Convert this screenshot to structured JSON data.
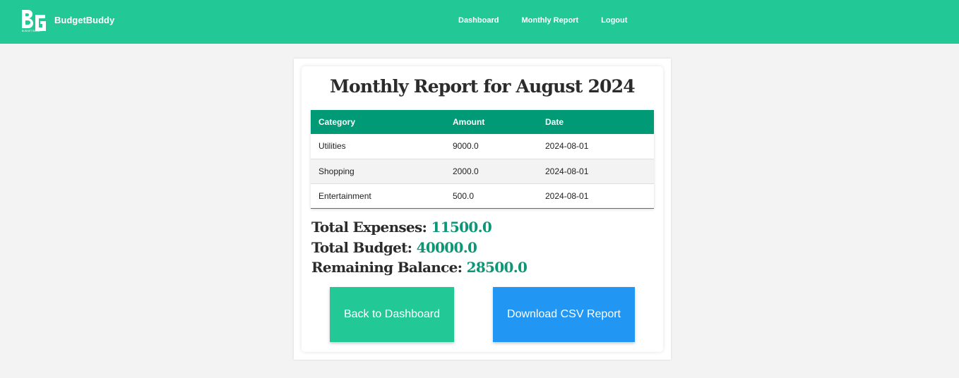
{
  "app": {
    "brand": "BudgetBuddy",
    "logo_text": "BG",
    "logo_tagline": "BUDGET BUDDY"
  },
  "nav": {
    "dashboard": "Dashboard",
    "monthly_report": "Monthly Report",
    "logout": "Logout"
  },
  "report": {
    "title": "Monthly Report for August 2024",
    "columns": [
      "Category",
      "Amount",
      "Date"
    ],
    "rows": [
      {
        "category": "Utilities",
        "amount": "9000.0",
        "date": "2024-08-01"
      },
      {
        "category": "Shopping",
        "amount": "2000.0",
        "date": "2024-08-01"
      },
      {
        "category": "Entertainment",
        "amount": "500.0",
        "date": "2024-08-01"
      }
    ]
  },
  "summary": {
    "total_expenses_label": "Total Expenses:",
    "total_expenses_value": "11500.0",
    "total_budget_label": "Total Budget:",
    "total_budget_value": "40000.0",
    "remaining_label": "Remaining Balance:",
    "remaining_value": "28500.0"
  },
  "buttons": {
    "back": "Back to Dashboard",
    "download": "Download CSV Report"
  },
  "colors": {
    "primary": "#22c997",
    "table_header": "#009a76",
    "value_text": "#0d9675",
    "download_button": "#2196f3",
    "background": "#f3f3f3"
  }
}
